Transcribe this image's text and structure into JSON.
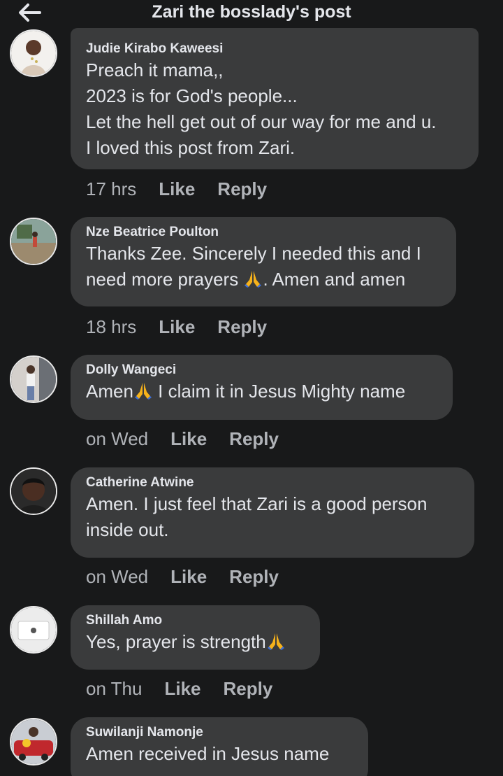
{
  "header": {
    "back_icon": "arrow-left-icon",
    "title": "Zari the bosslady's post"
  },
  "actions": {
    "like": "Like",
    "reply": "Reply"
  },
  "comments": [
    {
      "author": "Judie Kirabo Kaweesi",
      "text_lines": [
        "Preach it mama,,",
        "2023 is for God's people...",
        "Let the hell get out of our way for me and u.",
        "I loved this post from Zari."
      ],
      "time": "17 hrs"
    },
    {
      "author": "Nze Beatrice Poulton",
      "text_line1": "Thanks Zee. Sincerely I needed this and I",
      "text_line2_before": "need more prayers ",
      "text_line2_after": ". Amen and amen",
      "time": "18 hrs"
    },
    {
      "author": "Dolly Wangeci",
      "text_before": "Amen",
      "text_after": " I claim it in Jesus Mighty name",
      "time": "on Wed"
    },
    {
      "author": "Catherine Atwine",
      "text_lines": [
        "Amen.  I just feel that Zari is a good person",
        "inside out."
      ],
      "time": "on Wed"
    },
    {
      "author": "Shillah Amo",
      "text_before": "Yes, prayer is strength",
      "time": "on Thu"
    },
    {
      "author": "Suwilanji Namonje",
      "text": "Amen  received in Jesus name"
    }
  ],
  "emoji": "folded-hands-icon",
  "colors": {
    "background": "#18191a",
    "bubble": "#3a3b3c",
    "primary_text": "#e4e6eb",
    "secondary_text": "#b0b3b8"
  }
}
